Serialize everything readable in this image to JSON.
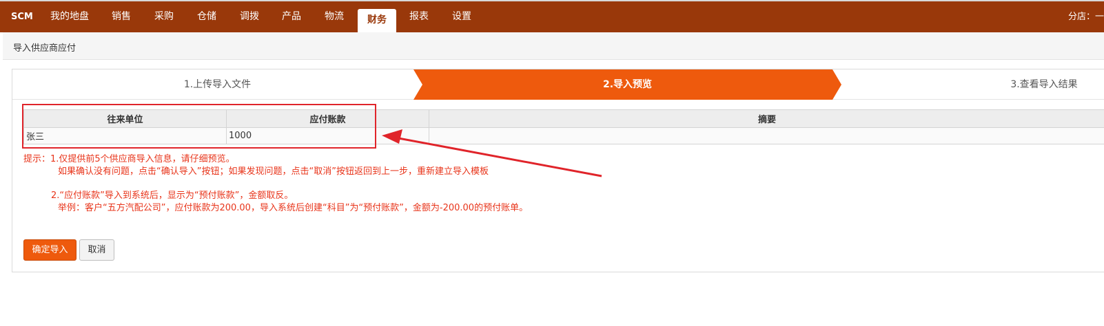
{
  "nav": {
    "brand": "SCM",
    "items": [
      {
        "label": "我的地盘"
      },
      {
        "label": "销售"
      },
      {
        "label": "采购"
      },
      {
        "label": "仓储"
      },
      {
        "label": "调拨"
      },
      {
        "label": "产品"
      },
      {
        "label": "物流"
      },
      {
        "label": "财务"
      },
      {
        "label": "报表"
      },
      {
        "label": "设置"
      }
    ],
    "active_index": 7,
    "store_label": "分店：一"
  },
  "page": {
    "title": "导入供应商应付"
  },
  "steps": [
    {
      "label": "1.上传导入文件"
    },
    {
      "label": "2.导入预览"
    },
    {
      "label": "3.查看导入结果"
    }
  ],
  "table": {
    "headers": [
      "往来单位",
      "应付账款",
      "摘要"
    ],
    "rows": [
      [
        "张三",
        "1000",
        ""
      ]
    ]
  },
  "hints": {
    "line1": "提示：1.仅提供前5个供应商导入信息，请仔细预览。",
    "line2": "如果确认没有问题，点击“确认导入”按钮；如果发现问题，点击“取消”按钮返回到上一步，重新建立导入模板",
    "line3": "2.“应付账款”导入到系统后，显示为“预付账款”，金额取反。",
    "line4": "举例：客户“五方汽配公司”，应付账款为200.00，导入系统后创建“科目”为“预付账款”，金额为-200.00的预付账单。"
  },
  "buttons": {
    "confirm": "确定导入",
    "cancel": "取消"
  },
  "colors": {
    "nav_bg": "#99380a",
    "accent": "#ee5a0d",
    "hint_text": "#e8341a",
    "annotation": "#e0242a"
  }
}
